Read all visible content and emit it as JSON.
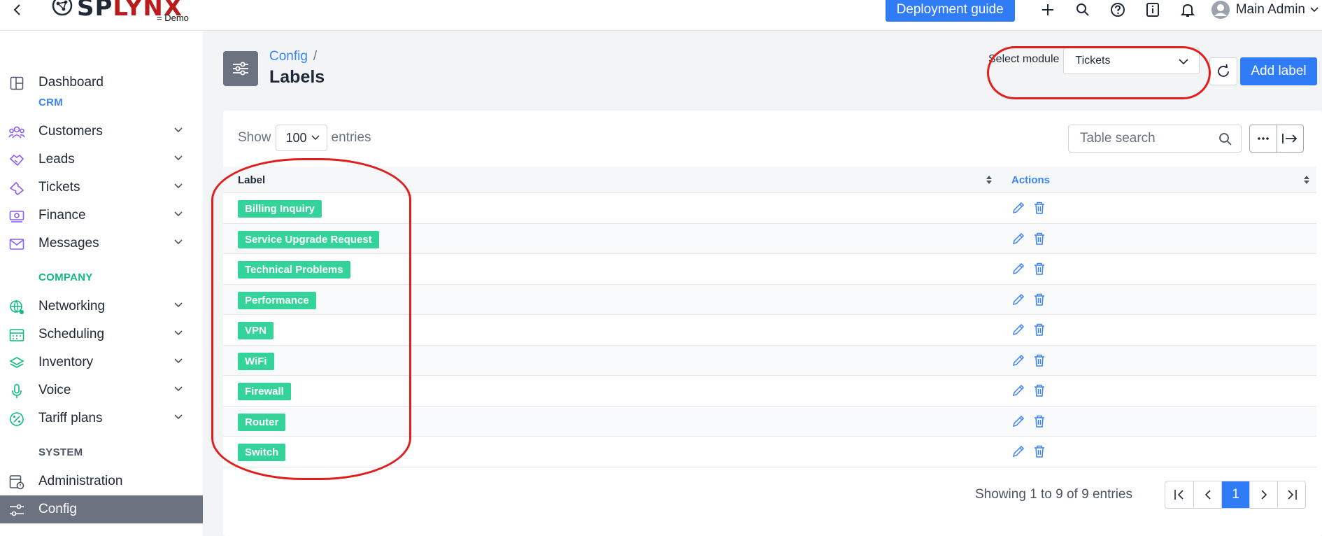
{
  "topbar": {
    "logo_text_a": "SP",
    "logo_text_b": "LYNX",
    "logo_sub": "= Demo",
    "deploy_label": "Deployment guide",
    "user_name": "Main Admin"
  },
  "sidebar": {
    "dashboard": "Dashboard",
    "crm_section": "CRM",
    "customers": "Customers",
    "leads": "Leads",
    "tickets": "Tickets",
    "finance": "Finance",
    "messages": "Messages",
    "company_section": "COMPANY",
    "networking": "Networking",
    "scheduling": "Scheduling",
    "inventory": "Inventory",
    "voice": "Voice",
    "tariff_plans": "Tariff plans",
    "system_section": "SYSTEM",
    "administration": "Administration",
    "config": "Config"
  },
  "header": {
    "breadcrumb": "Config",
    "breadcrumb_sep": "/",
    "title": "Labels",
    "select_module_label": "Select module",
    "select_module_value": "Tickets",
    "add_label": "Add label"
  },
  "table": {
    "show_label": "Show",
    "entries_value": "100",
    "entries_label": "entries",
    "search_placeholder": "Table search",
    "col_label": "Label",
    "col_actions": "Actions",
    "rows": [
      "Billing Inquiry",
      "Service Upgrade Request",
      "Technical Problems",
      "Performance",
      "VPN",
      "WiFi",
      "Firewall",
      "Router",
      "Switch"
    ],
    "showing_text": "Showing 1 to 9 of 9 entries",
    "current_page": "1"
  },
  "colors": {
    "accent": "#2f7cf6",
    "tag": "#34d399",
    "highlight": "#e11d1d",
    "sidebar_active": "#6b7280"
  }
}
